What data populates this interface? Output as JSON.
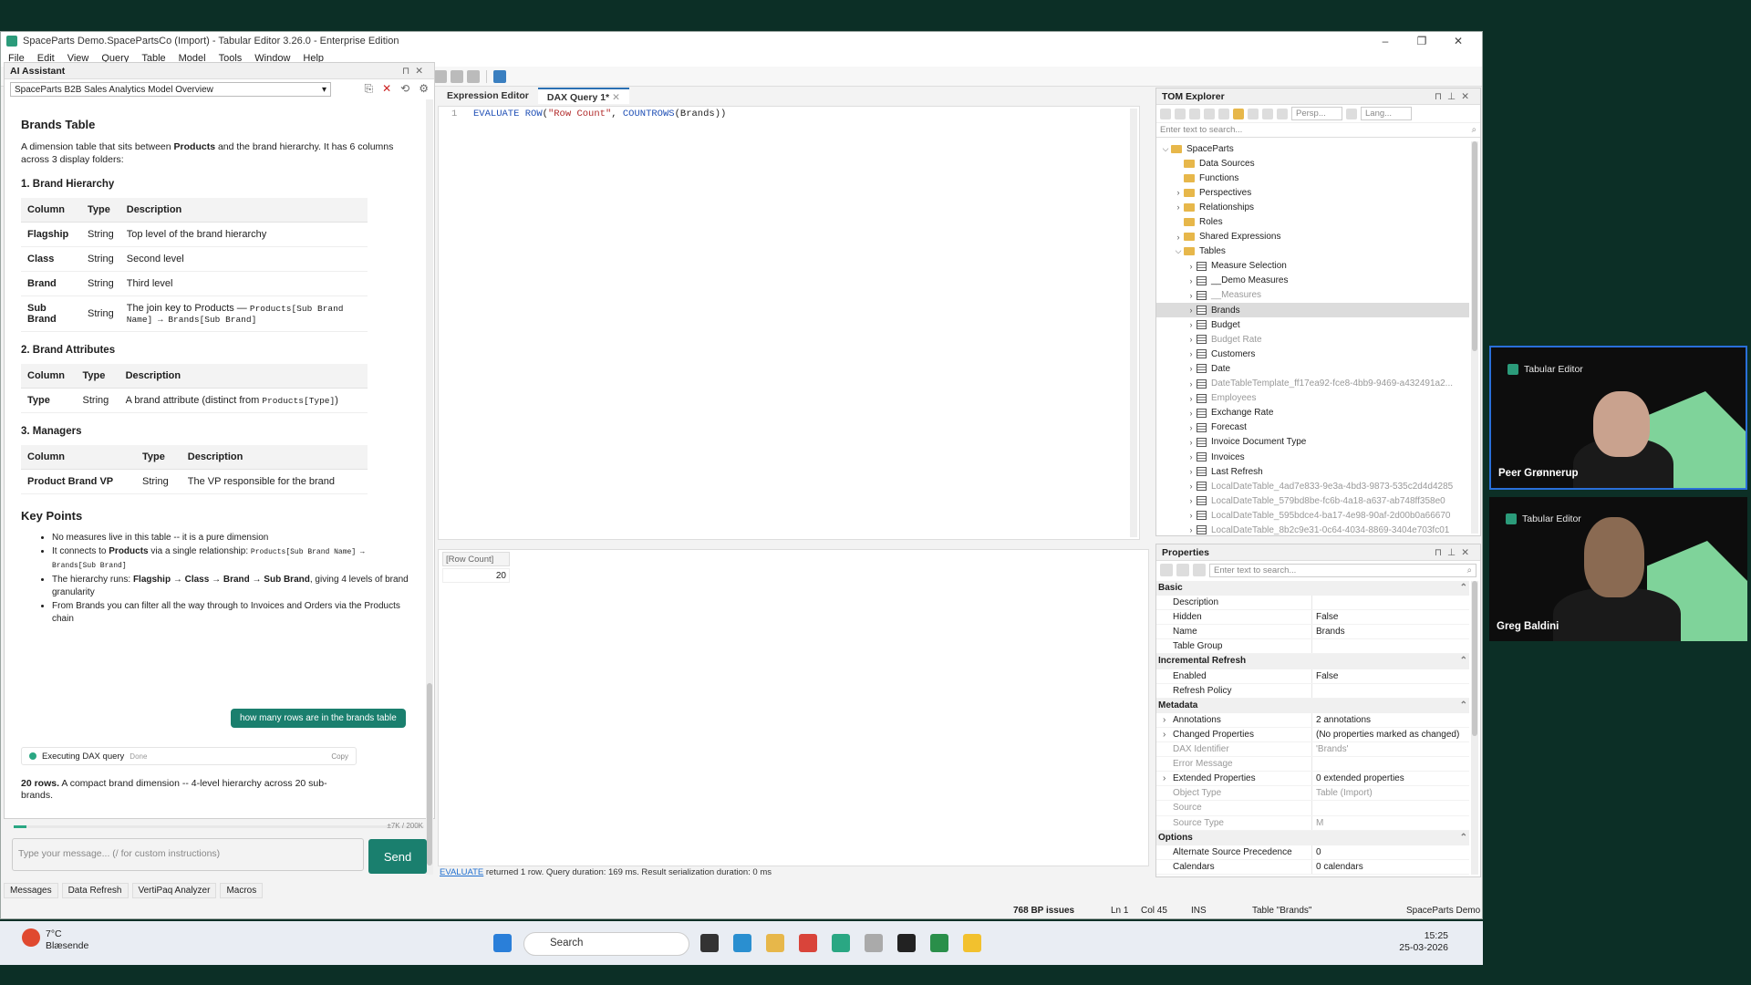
{
  "window": {
    "title": "SpaceParts Demo.SpacePartsCo (Import) - Tabular Editor 3.26.0 - Enterprise Edition",
    "menu": [
      "File",
      "Edit",
      "View",
      "Query",
      "Table",
      "Model",
      "Tools",
      "Window",
      "Help"
    ]
  },
  "ai": {
    "panel_title": "AI Assistant",
    "conversation": "SpaceParts B2B Sales Analytics Model Overview",
    "heading": "Brands Table",
    "intro_prefix": "A dimension table that sits between ",
    "intro_bold": "Products",
    "intro_suffix": " and the brand hierarchy. It has 6 columns across 3 display folders:",
    "sec1": "1. Brand Hierarchy",
    "sec2": "2. Brand Attributes",
    "sec3": "3. Managers",
    "col_h": "Column",
    "type_h": "Type",
    "desc_h": "Description",
    "t1": [
      {
        "c": "Flagship",
        "t": "String",
        "d": "Top level of the brand hierarchy"
      },
      {
        "c": "Class",
        "t": "String",
        "d": "Second level"
      },
      {
        "c": "Brand",
        "t": "String",
        "d": "Third level"
      },
      {
        "c": "Sub Brand",
        "t": "String",
        "d": "The join key to Products — ",
        "code": "Products[Sub Brand Name] → Brands[Sub Brand]"
      }
    ],
    "t2": {
      "c": "Type",
      "t": "String",
      "d": "A brand attribute (distinct from ",
      "code": "Products[Type]",
      "d2": ")"
    },
    "t3": {
      "c": "Product Brand VP",
      "t": "String",
      "d": "The VP responsible for the brand"
    },
    "kp_title": "Key Points",
    "kp1": "No measures live in this table -- it is a pure dimension",
    "kp2a": "It connects to ",
    "kp2b": "Products",
    "kp2c": " via a single relationship: ",
    "kp2code": "Products[Sub Brand Name] → Brands[Sub Brand]",
    "kp3a": "The hierarchy runs: ",
    "kp3b": "Flagship → Class → Brand → Sub Brand",
    "kp3c": ", giving 4 levels of brand granularity",
    "kp4": "From Brands you can filter all the way through to Invoices and Orders via the Products chain",
    "user_msg": "how many rows are in the brands table",
    "exec_label": "Executing DAX query",
    "exec_state": "Done",
    "copy": "Copy",
    "result_bold": "20 rows.",
    "result_rest": " A compact brand dimension -- 4-level hierarchy across 20 sub-brands.",
    "counter": "±7K / 200K",
    "placeholder": "Type your message... (/ for custom instructions)",
    "send": "Send"
  },
  "editor": {
    "tab1": "Expression Editor",
    "tab2": "DAX Query 1*",
    "line_no": "1",
    "code_kw": "EVALUATE",
    "code_fn": "ROW",
    "code_str": "\"Row Count\"",
    "code_fn2": "COUNTROWS",
    "code_tail": "(Brands))",
    "result_header": "[Row Count]",
    "result_value": "20",
    "status_kw": "EVALUATE",
    "status_text": " returned 1 row. Query duration: 169 ms. Result serialization duration: 0 ms"
  },
  "tom": {
    "title": "TOM Explorer",
    "persp": "Persp...",
    "lang": "Lang...",
    "search": "Enter text to search...",
    "root": "SpaceParts",
    "folders": [
      "Data Sources",
      "Functions",
      "Perspectives",
      "Relationships",
      "Roles",
      "Shared Expressions",
      "Tables"
    ],
    "tables": [
      {
        "n": "Measure Selection",
        "dim": false
      },
      {
        "n": "__Demo Measures",
        "dim": false
      },
      {
        "n": "__Measures",
        "dim": true
      },
      {
        "n": "Brands",
        "dim": false,
        "sel": true
      },
      {
        "n": "Budget",
        "dim": false
      },
      {
        "n": "Budget Rate",
        "dim": true
      },
      {
        "n": "Customers",
        "dim": false
      },
      {
        "n": "Date",
        "dim": false
      },
      {
        "n": "DateTableTemplate_ff17ea92-fce8-4bb9-9469-a432491a2...",
        "dim": true
      },
      {
        "n": "Employees",
        "dim": true
      },
      {
        "n": "Exchange Rate",
        "dim": false
      },
      {
        "n": "Forecast",
        "dim": false
      },
      {
        "n": "Invoice Document Type",
        "dim": false
      },
      {
        "n": "Invoices",
        "dim": false
      },
      {
        "n": "Last Refresh",
        "dim": false
      },
      {
        "n": "LocalDateTable_4ad7e833-9e3a-4bd3-9873-535c2d4d4285",
        "dim": true
      },
      {
        "n": "LocalDateTable_579bd8be-fc6b-4a18-a637-ab748ff358e0",
        "dim": true
      },
      {
        "n": "LocalDateTable_595bdce4-ba17-4e98-90af-2d00b0a66670",
        "dim": true
      },
      {
        "n": "LocalDateTable_8b2c9e31-0c64-4034-8869-3404e703fc01",
        "dim": true
      }
    ]
  },
  "props": {
    "title": "Properties",
    "search": "Enter text to search...",
    "cats": {
      "basic": "Basic",
      "inc": "Incremental Refresh",
      "meta": "Metadata",
      "opt": "Options"
    },
    "basic": [
      [
        "Description",
        ""
      ],
      [
        "Hidden",
        "False"
      ],
      [
        "Name",
        "Brands"
      ],
      [
        "Table Group",
        ""
      ]
    ],
    "inc": [
      [
        "Enabled",
        "False"
      ],
      [
        "Refresh Policy",
        ""
      ]
    ],
    "meta": [
      [
        "Annotations",
        "2 annotations"
      ],
      [
        "Changed Properties",
        "(No properties marked as changed)"
      ],
      [
        "DAX Identifier",
        "'Brands'"
      ],
      [
        "Error Message",
        ""
      ],
      [
        "Extended Properties",
        "0 extended properties"
      ],
      [
        "Object Type",
        "Table (Import)"
      ],
      [
        "Source",
        ""
      ],
      [
        "Source Type",
        "M"
      ]
    ],
    "opt": [
      [
        "Alternate Source Precedence",
        "0"
      ],
      [
        "Calendars",
        "0 calendars"
      ]
    ]
  },
  "bottom_tabs": [
    "Messages",
    "Data Refresh",
    "VertiPaq Analyzer",
    "Macros"
  ],
  "statusbar": {
    "issues": "768 BP issues",
    "ln": "Ln 1",
    "col": "Col 45",
    "ins": "INS",
    "table": "Table \"Brands\"",
    "model": "SpaceParts Demo"
  },
  "taskbar": {
    "temp": "7°C",
    "weather": "Blæsende",
    "search": "Search",
    "time": "15:25",
    "date": "25-03-2026"
  },
  "video": {
    "app": "Tabular Editor",
    "p1": "Peer Grønnerup",
    "p2": "Greg Baldini"
  }
}
